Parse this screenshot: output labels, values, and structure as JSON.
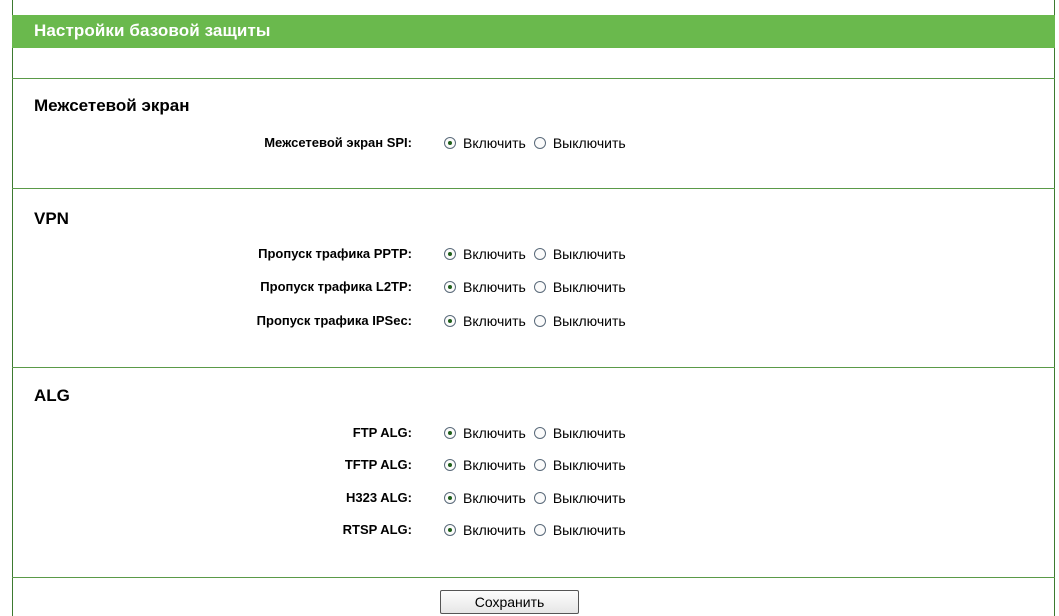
{
  "header": {
    "title": "Настройки базовой защиты"
  },
  "options": {
    "on": "Включить",
    "off": "Выключить"
  },
  "firewall": {
    "title": "Межсетевой экран",
    "rows": [
      {
        "label": "Межсетевой экран SPI:",
        "value": "on"
      }
    ]
  },
  "vpn": {
    "title": "VPN",
    "rows": [
      {
        "label": "Пропуск трафика PPTP:",
        "value": "on"
      },
      {
        "label": "Пропуск трафика L2TP:",
        "value": "on"
      },
      {
        "label": "Пропуск трафика IPSec:",
        "value": "on"
      }
    ]
  },
  "alg": {
    "title": "ALG",
    "rows": [
      {
        "label": "FTP ALG:",
        "value": "on"
      },
      {
        "label": "TFTP ALG:",
        "value": "on"
      },
      {
        "label": "H323 ALG:",
        "value": "on"
      },
      {
        "label": "RTSP ALG:",
        "value": "on"
      }
    ]
  },
  "actions": {
    "save_label": "Сохранить"
  },
  "colors": {
    "header_bg": "#6ab94d",
    "divider": "#5a9a48",
    "frame": "#3d7a30"
  }
}
